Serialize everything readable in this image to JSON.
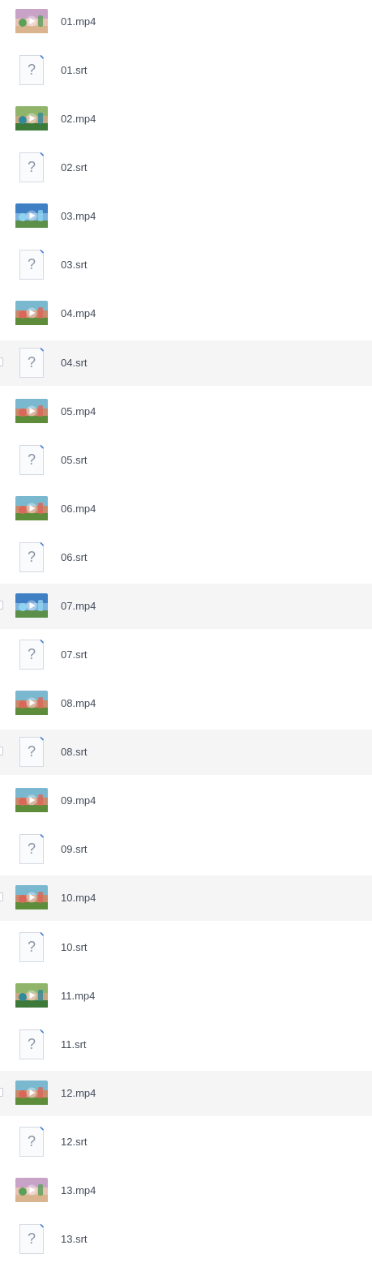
{
  "files": [
    {
      "name": "01.mp4",
      "type": "video",
      "thumb": "thumb-pink"
    },
    {
      "name": "01.srt",
      "type": "unknown"
    },
    {
      "name": "02.mp4",
      "type": "video",
      "thumb": "thumb-forest"
    },
    {
      "name": "02.srt",
      "type": "unknown"
    },
    {
      "name": "03.mp4",
      "type": "video",
      "thumb": "thumb-sky"
    },
    {
      "name": "03.srt",
      "type": "unknown"
    },
    {
      "name": "04.mp4",
      "type": "video",
      "thumb": "thumb-meadow"
    },
    {
      "name": "04.srt",
      "type": "unknown",
      "highlighted": true
    },
    {
      "name": "05.mp4",
      "type": "video",
      "thumb": "thumb-meadow"
    },
    {
      "name": "05.srt",
      "type": "unknown"
    },
    {
      "name": "06.mp4",
      "type": "video",
      "thumb": "thumb-meadow"
    },
    {
      "name": "06.srt",
      "type": "unknown"
    },
    {
      "name": "07.mp4",
      "type": "video",
      "thumb": "thumb-sky",
      "highlighted": true
    },
    {
      "name": "07.srt",
      "type": "unknown"
    },
    {
      "name": "08.mp4",
      "type": "video",
      "thumb": "thumb-meadow"
    },
    {
      "name": "08.srt",
      "type": "unknown",
      "highlighted": true
    },
    {
      "name": "09.mp4",
      "type": "video",
      "thumb": "thumb-meadow"
    },
    {
      "name": "09.srt",
      "type": "unknown"
    },
    {
      "name": "10.mp4",
      "type": "video",
      "thumb": "thumb-meadow",
      "highlighted": true
    },
    {
      "name": "10.srt",
      "type": "unknown"
    },
    {
      "name": "11.mp4",
      "type": "video",
      "thumb": "thumb-forest"
    },
    {
      "name": "11.srt",
      "type": "unknown"
    },
    {
      "name": "12.mp4",
      "type": "video",
      "thumb": "thumb-meadow",
      "highlighted": true
    },
    {
      "name": "12.srt",
      "type": "unknown"
    },
    {
      "name": "13.mp4",
      "type": "video",
      "thumb": "thumb-pink"
    },
    {
      "name": "13.srt",
      "type": "unknown"
    }
  ],
  "colors": {
    "row_highlight": "#f5f5f6",
    "text": "#454d5a",
    "doc_border": "#d5d9e2",
    "doc_glyph": "#8d94a6",
    "doc_fold": "#4a7bd6"
  }
}
